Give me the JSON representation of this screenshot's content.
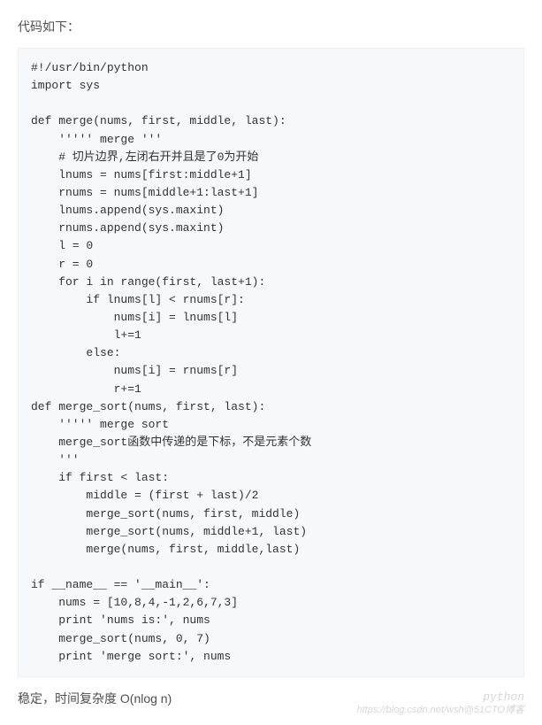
{
  "intro": "代码如下：",
  "code_lines": [
    "#!/usr/bin/python",
    "import sys",
    "",
    "def merge(nums, first, middle, last):",
    "    ''''' merge '''",
    "    # 切片边界,左闭右开并且是了0为开始",
    "    lnums = nums[first:middle+1]",
    "    rnums = nums[middle+1:last+1]",
    "    lnums.append(sys.maxint)",
    "    rnums.append(sys.maxint)",
    "    l = 0",
    "    r = 0",
    "    for i in range(first, last+1):",
    "        if lnums[l] < rnums[r]:",
    "            nums[i] = lnums[l]",
    "            l+=1",
    "        else:",
    "            nums[i] = rnums[r]",
    "            r+=1",
    "def merge_sort(nums, first, last):",
    "    ''''' merge sort",
    "    merge_sort函数中传递的是下标，不是元素个数",
    "    '''",
    "    if first < last:",
    "        middle = (first + last)/2",
    "        merge_sort(nums, first, middle)",
    "        merge_sort(nums, middle+1, last)",
    "        merge(nums, first, middle,last)",
    "",
    "if __name__ == '__main__':",
    "    nums = [10,8,4,-1,2,6,7,3]",
    "    print 'nums is:', nums",
    "    merge_sort(nums, 0, 7)",
    "    print 'merge sort:', nums"
  ],
  "outro": "稳定，时间复杂度 O(nlog n)",
  "watermark": {
    "line1": "python",
    "line2": "https://blog.csdn.net/wsh@51CTO博客"
  }
}
